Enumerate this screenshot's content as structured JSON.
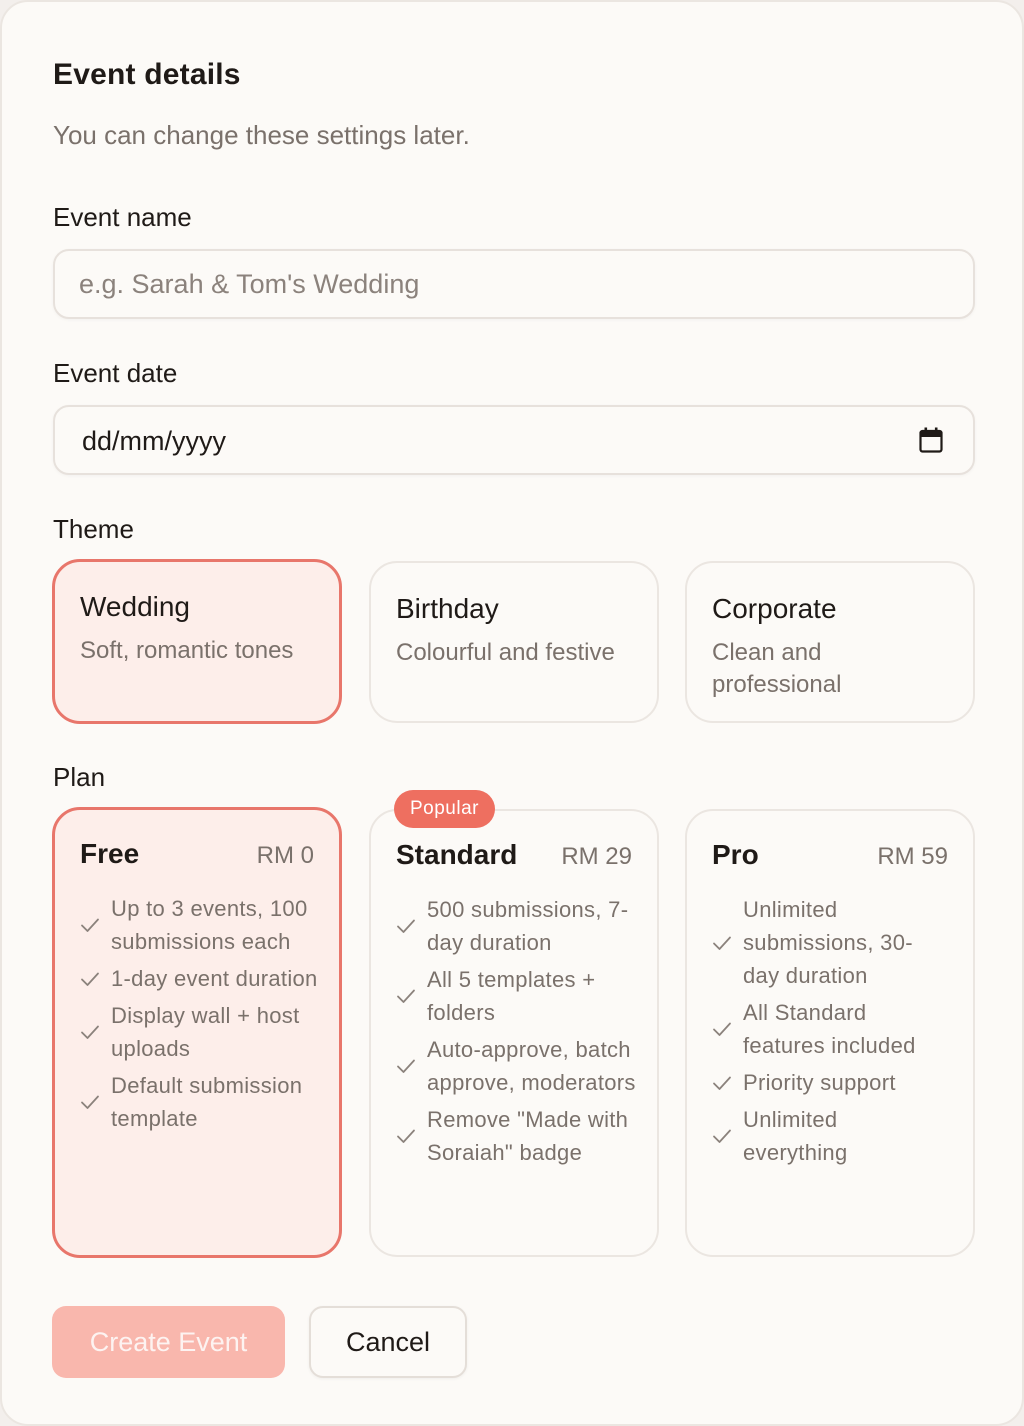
{
  "header": {
    "title": "Event details",
    "subtitle": "You can change these settings later."
  },
  "event_name": {
    "label": "Event name",
    "placeholder": "e.g. Sarah & Tom's Wedding",
    "value": ""
  },
  "event_date": {
    "label": "Event date",
    "value": "dd/mm/yyyy",
    "icon": "calendar-icon"
  },
  "theme": {
    "label": "Theme",
    "selected": "Wedding",
    "options": [
      {
        "name": "Wedding",
        "description": "Soft, romantic tones"
      },
      {
        "name": "Birthday",
        "description": "Colourful and festive"
      },
      {
        "name": "Corporate",
        "description": "Clean and professional"
      }
    ]
  },
  "plan": {
    "label": "Plan",
    "selected": "Free",
    "badge": "Popular",
    "options": [
      {
        "name": "Free",
        "price": "RM 0",
        "features": [
          "Up to 3 events, 100 submissions each",
          "1-day event duration",
          "Display wall + host uploads",
          "Default submission template"
        ]
      },
      {
        "name": "Standard",
        "price": "RM 29",
        "features": [
          "500 submissions, 7-day duration",
          "All 5 templates + folders",
          "Auto-approve, batch approve, moderators",
          "Remove \"Made with Soraiah\" badge"
        ]
      },
      {
        "name": "Pro",
        "price": "RM 59",
        "features": [
          "Unlimited submissions, 30-day duration",
          "All Standard features included",
          "Priority support",
          "Unlimited everything"
        ]
      }
    ]
  },
  "actions": {
    "create_label": "Create Event",
    "cancel_label": "Cancel"
  },
  "colors": {
    "accent": "#e8766b",
    "badge": "#ee6f60",
    "selected_bg": "#fdeeea",
    "primary_disabled": "#f9b7ad"
  }
}
